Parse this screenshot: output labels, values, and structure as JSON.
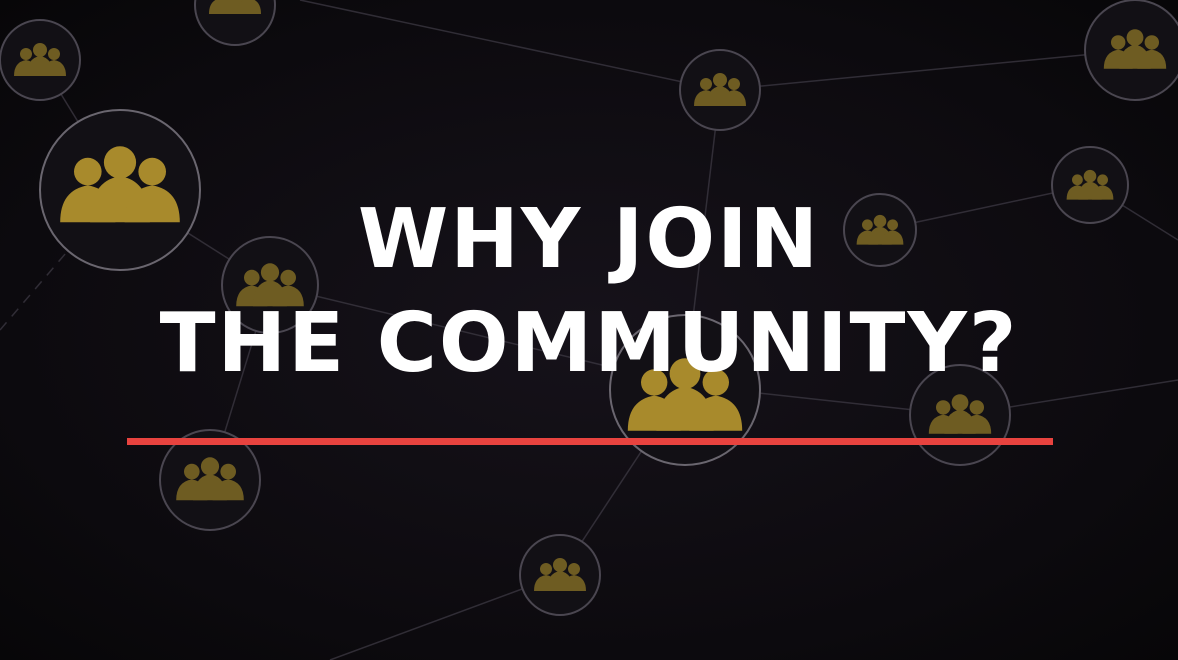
{
  "headline": {
    "line1": "WHY JOIN",
    "line2": "THE COMMUNITY?"
  },
  "colors": {
    "background": "#0d0b0f",
    "text": "#ffffff",
    "accent_underline": "#e8433f",
    "node_icon": "#a88a2c"
  },
  "icons": [
    "community-node-icon",
    "people-group-icon"
  ]
}
